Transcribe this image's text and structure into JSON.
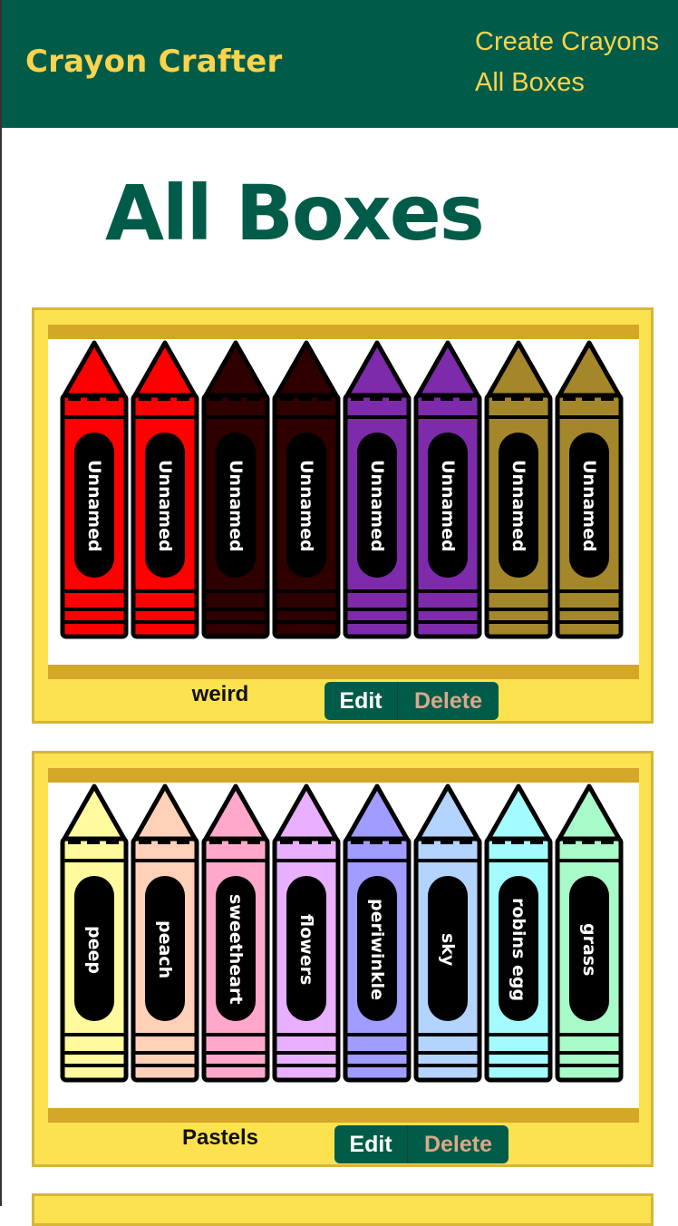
{
  "header": {
    "brand": "Crayon Crafter",
    "nav": {
      "create": "Create Crayons",
      "all_boxes": "All Boxes"
    }
  },
  "page": {
    "title": "All Boxes"
  },
  "actions": {
    "edit_label": "Edit",
    "delete_label": "Delete"
  },
  "boxes": [
    {
      "name": "weird",
      "crayons": [
        {
          "name": "Unnamed",
          "color": "#ff0000",
          "stripe": "#ff0000"
        },
        {
          "name": "Unnamed",
          "color": "#ff0000",
          "stripe": "#ff0000"
        },
        {
          "name": "Unnamed",
          "color": "#2e0000",
          "stripe": "#2e0000"
        },
        {
          "name": "Unnamed",
          "color": "#2e0000",
          "stripe": "#2e0000"
        },
        {
          "name": "Unnamed",
          "color": "#7e2bab",
          "stripe": "#7e2bab"
        },
        {
          "name": "Unnamed",
          "color": "#7e2bab",
          "stripe": "#7e2bab"
        },
        {
          "name": "Unnamed",
          "color": "#a3872a",
          "stripe": "#a3872a"
        },
        {
          "name": "Unnamed",
          "color": "#a3872a",
          "stripe": "#a3872a"
        }
      ]
    },
    {
      "name": "Pastels",
      "crayons": [
        {
          "name": "peep",
          "color": "#fffa9e",
          "stripe": "#fffa9e"
        },
        {
          "name": "peach",
          "color": "#ffd1b8",
          "stripe": "#ffd1b8"
        },
        {
          "name": "sweetheart",
          "color": "#ffa8cc",
          "stripe": "#ffa8cc"
        },
        {
          "name": "flowers",
          "color": "#e8b0ff",
          "stripe": "#e8b0ff"
        },
        {
          "name": "periwinkle",
          "color": "#a19cff",
          "stripe": "#a19cff"
        },
        {
          "name": "sky",
          "color": "#b3d4ff",
          "stripe": "#b3d4ff"
        },
        {
          "name": "robins egg",
          "color": "#a3faff",
          "stripe": "#a3faff"
        },
        {
          "name": "grass",
          "color": "#a8fac8",
          "stripe": "#a8fac8"
        }
      ]
    }
  ]
}
